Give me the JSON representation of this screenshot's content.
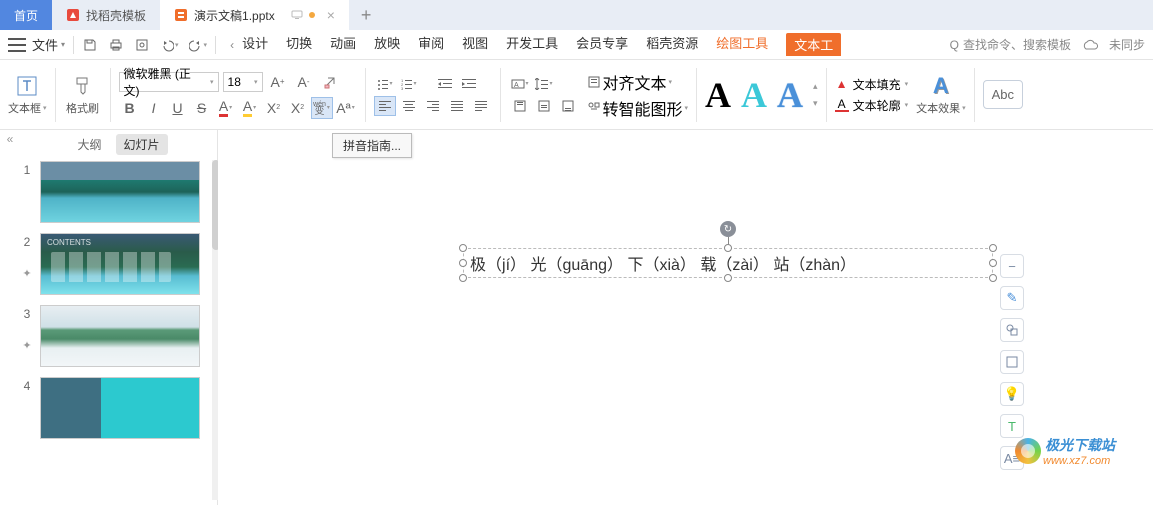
{
  "tabs": {
    "home": "首页",
    "template": "找稻壳模板",
    "doc": "演示文稿1.pptx",
    "plus": "+"
  },
  "menu": {
    "file": "文件",
    "items": [
      "设计",
      "切换",
      "动画",
      "放映",
      "审阅",
      "视图",
      "开发工具",
      "会员专享",
      "稻壳资源"
    ],
    "draw": "绘图工具",
    "text": "文本工",
    "search_placeholder": "查找命令、搜索模板",
    "search_icon_label": "Q",
    "unsynced": "未同步"
  },
  "ribbon": {
    "textbox": "文本框",
    "format_painter": "格式刷",
    "font_name": "微软雅黑 (正文)",
    "font_size": "18",
    "pinyin_icon": "wén",
    "pinyin_sub": "变",
    "align_text": "对齐文本",
    "smart_graphic": "转智能图形",
    "fill": "文本填充",
    "outline": "文本轮廓",
    "effect": "文本效果",
    "abc": "Abc"
  },
  "tooltip": "拼音指南...",
  "side": {
    "outline": "大纲",
    "slides": "幻灯片",
    "thumb2_label": "CONTENTS"
  },
  "slide_text": {
    "c1": "极",
    "p1": "（jí）",
    "c2": "光",
    "p2": "（guāng）",
    "c3": "下",
    "p3": "（xià）",
    "c4": "载",
    "p4": "（zài）",
    "c5": "站",
    "p5": "（zhàn）"
  },
  "watermark": {
    "main": "极光下载站",
    "sub": "www.xz7.com"
  },
  "slide_numbers": [
    "1",
    "2",
    "3",
    "4"
  ]
}
